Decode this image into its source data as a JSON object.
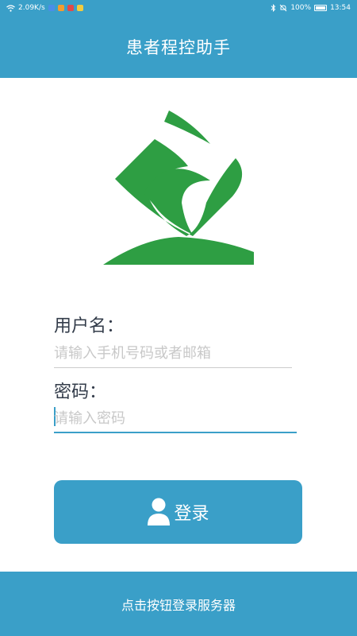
{
  "status_bar": {
    "speed": "2.09K/s",
    "battery": "100%",
    "time": "13:54",
    "icons": [
      "wifi-icon",
      "bluetooth-icon",
      "mute-icon",
      "battery-icon"
    ]
  },
  "header": {
    "title": "患者程控助手"
  },
  "logo": {
    "icon": "app-logo",
    "color": "#2e9e43"
  },
  "form": {
    "username_label": "用户名：",
    "username_placeholder": "请输入手机号码或者邮箱",
    "password_label": "密码：",
    "password_placeholder": "请输入密码"
  },
  "login_button": {
    "label": "登录",
    "icon": "user-icon"
  },
  "footer": {
    "text": "点击按钮登录服务器"
  },
  "colors": {
    "primary": "#3a9fc8",
    "logo_green": "#2e9e43",
    "label_text": "#333c4a",
    "placeholder": "#c8c8c8"
  }
}
